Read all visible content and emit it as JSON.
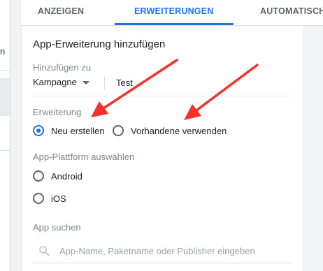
{
  "sidebar": {
    "fragment_text": "n"
  },
  "tabs": [
    {
      "label": "ANZEIGEN",
      "active": false
    },
    {
      "label": "ERWEITERUNGEN",
      "active": true
    },
    {
      "label": "AUTOMATISCHE",
      "active": false
    }
  ],
  "panel": {
    "title": "App-Erweiterung hinzufügen",
    "add_to": {
      "label": "Hinzufügen zu",
      "dropdown_value": "Kampagne",
      "value": "Test"
    },
    "extension": {
      "label": "Erweiterung",
      "options": [
        {
          "label": "Neu erstellen",
          "checked": true
        },
        {
          "label": "Vorhandene verwenden",
          "checked": false
        }
      ]
    },
    "platform": {
      "label": "App-Plattform auswählen",
      "options": [
        {
          "label": "Android",
          "checked": false
        },
        {
          "label": "iOS",
          "checked": false
        }
      ]
    },
    "app_search": {
      "label": "App suchen",
      "placeholder": "App-Name, Paketname oder Publisher eingeben"
    }
  },
  "colors": {
    "accent": "#1a73e8",
    "annotation_arrow": "#f4312b"
  },
  "icons": [
    "search-icon",
    "dropdown-caret-icon"
  ]
}
